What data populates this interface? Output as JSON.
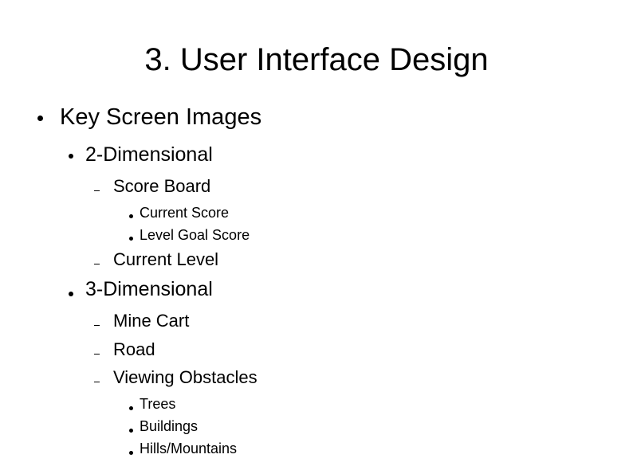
{
  "slide": {
    "title": "3. User Interface Design",
    "outline": {
      "heading": "Key Screen Images",
      "sections": [
        {
          "label": "2-Dimensional",
          "items": [
            {
              "label": "Score Board",
              "subitems": [
                "Current Score",
                "Level Goal Score"
              ]
            },
            {
              "label": "Current Level",
              "subitems": []
            }
          ]
        },
        {
          "label": "3-Dimensional",
          "items": [
            {
              "label": "Mine Cart",
              "subitems": []
            },
            {
              "label": "Road",
              "subitems": []
            },
            {
              "label": "Viewing Obstacles",
              "subitems": [
                "Trees",
                "Buildings",
                "Hills/Mountains"
              ]
            }
          ]
        }
      ]
    },
    "bullet_icons": {
      "level1": "filled-circle",
      "level2": "filled-circle",
      "level3": "en-dash",
      "level4": "filled-circle"
    }
  }
}
